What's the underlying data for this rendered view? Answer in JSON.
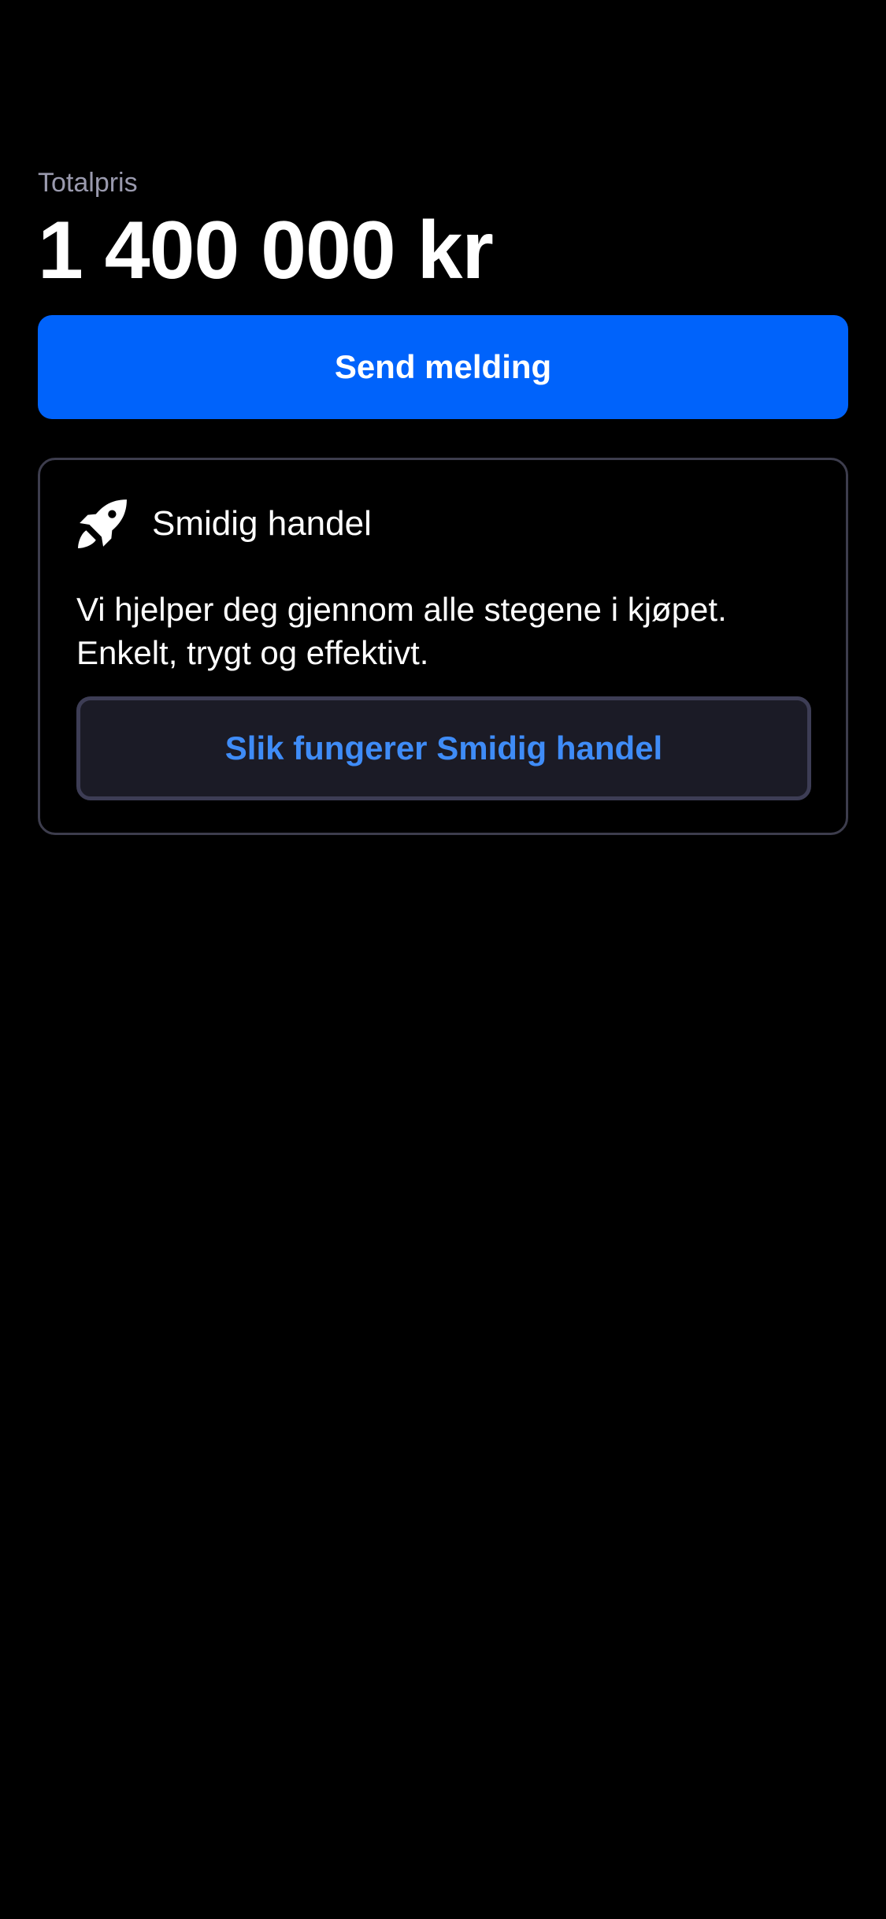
{
  "price": {
    "label": "Totalpris",
    "value": "1 400 000 kr"
  },
  "actions": {
    "send_message_label": "Send melding"
  },
  "smidig_card": {
    "icon": "rocket-icon",
    "title": "Smidig handel",
    "description_line1": "Vi hjelper deg gjennom alle stegene i kjøpet.",
    "description_line2": "Enkelt, trygt og effektivt.",
    "link_label": "Slik fungerer Smidig handel"
  },
  "colors": {
    "background": "#000000",
    "primary": "#0063fb",
    "link": "#3f8cf7",
    "card_border": "#3d3d4d",
    "muted_text": "#9a9aae"
  }
}
